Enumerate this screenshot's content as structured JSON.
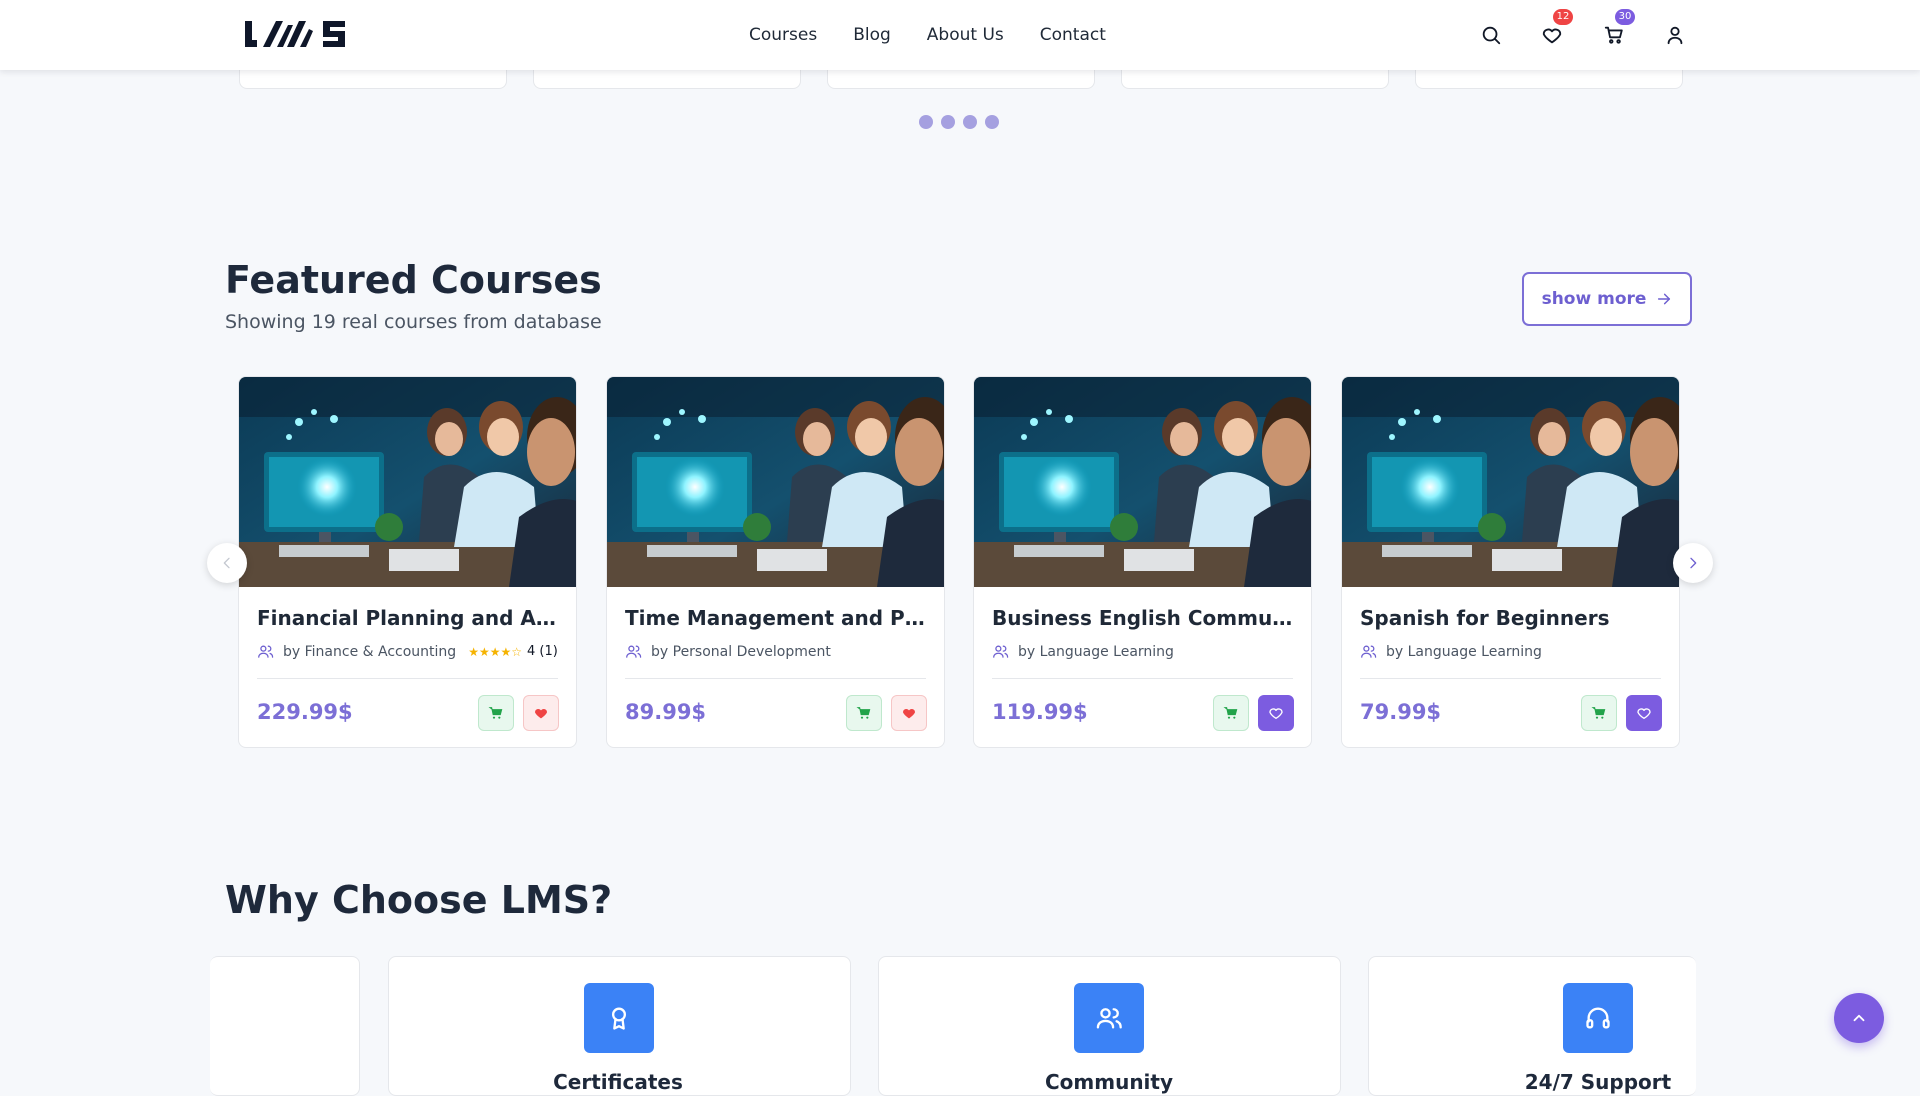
{
  "header": {
    "logo_text": "LMS",
    "nav": [
      "Courses",
      "Blog",
      "About Us",
      "Contact"
    ],
    "wishlist_count": "12",
    "cart_count": "30",
    "icons": [
      "search-icon",
      "heart-icon",
      "cart-icon",
      "user-icon"
    ]
  },
  "carousel_top": {
    "dot_count": 4
  },
  "featured": {
    "title": "Featured Courses",
    "subtitle": "Showing 19 real courses from database",
    "show_more": "show more",
    "courses": [
      {
        "title": "Financial Planning and Analysis",
        "category": "by Finance & Accounting",
        "rating": 4,
        "rating_text": "4 (1)",
        "price": "229.99$",
        "wishlisted": false
      },
      {
        "title": "Time Management and Productivity",
        "category": "by Personal Development",
        "price": "89.99$",
        "wishlisted": false
      },
      {
        "title": "Business English Communication",
        "category": "by Language Learning",
        "price": "119.99$",
        "wishlisted": true
      },
      {
        "title": "Spanish for Beginners",
        "category": "by Language Learning",
        "price": "79.99$",
        "wishlisted": true
      }
    ]
  },
  "why": {
    "title": "Why Choose LMS?",
    "features": [
      {
        "label": "Certificates",
        "icon": "award-icon"
      },
      {
        "label": "Community",
        "icon": "users-icon"
      },
      {
        "label": "24/7 Support",
        "icon": "headphones-icon"
      }
    ]
  },
  "colors": {
    "accent": "#7c6fd6",
    "purple": "#7c5ce0",
    "blue": "#3b82f6",
    "wishlist_badge": "#ef4444",
    "cart_badge": "#7c5ce0"
  }
}
